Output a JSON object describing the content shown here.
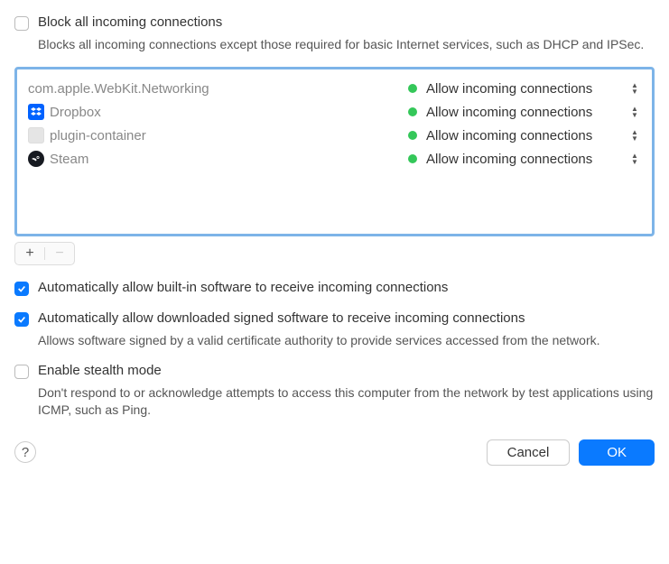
{
  "block_all": {
    "label": "Block all incoming connections",
    "desc": "Blocks all incoming connections except those required for basic Internet services, such as DHCP and IPSec.",
    "checked": false
  },
  "apps": [
    {
      "name": "com.apple.WebKit.Networking",
      "icon": "none",
      "status": "Allow incoming connections"
    },
    {
      "name": "Dropbox",
      "icon": "dropbox",
      "status": "Allow incoming connections"
    },
    {
      "name": "plugin-container",
      "icon": "plugin",
      "status": "Allow incoming connections"
    },
    {
      "name": "Steam",
      "icon": "steam",
      "status": "Allow incoming connections"
    }
  ],
  "toolbar": {
    "add": "+",
    "remove": "−"
  },
  "auto_builtin": {
    "label": "Automatically allow built-in software to receive incoming connections",
    "checked": true
  },
  "auto_signed": {
    "label": "Automatically allow downloaded signed software to receive incoming connections",
    "desc": "Allows software signed by a valid certificate authority to provide services accessed from the network.",
    "checked": true
  },
  "stealth": {
    "label": "Enable stealth mode",
    "desc": "Don't respond to or acknowledge attempts to access this computer from the network by test applications using ICMP, such as Ping.",
    "checked": false
  },
  "footer": {
    "help": "?",
    "cancel": "Cancel",
    "ok": "OK"
  }
}
